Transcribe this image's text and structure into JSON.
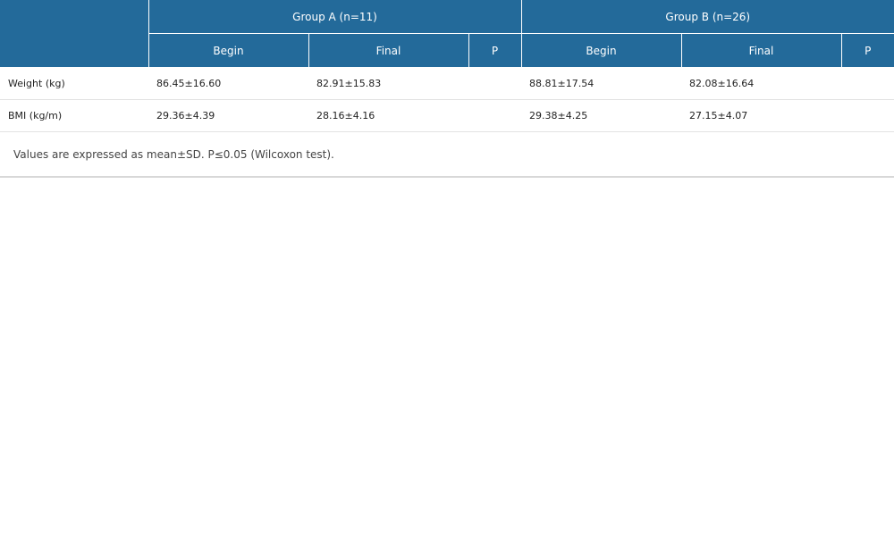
{
  "table": {
    "corner_label": "",
    "groups": [
      {
        "label": "Group A (n=11)"
      },
      {
        "label": "Group B (n=26)"
      }
    ],
    "subheaders": [
      "Begin",
      "Final",
      "P",
      "Begin",
      "Final",
      "P"
    ],
    "rows": [
      {
        "label": "Weight (kg)",
        "cells": [
          "86.45±16.60",
          "82.91±15.83",
          "",
          "88.81±17.54",
          "82.08±16.64",
          ""
        ]
      },
      {
        "label": "BMI (kg/m)",
        "cells": [
          "29.36±4.39",
          "28.16±4.16",
          "",
          "29.38±4.25",
          "27.15±4.07",
          ""
        ]
      }
    ],
    "note": "Values are expressed as mean±SD. P≤0.05 (Wilcoxon test)."
  },
  "colors": {
    "header_bg": "#236a9a",
    "header_text": "#ffffff",
    "row_divider": "#e2e2e2"
  }
}
